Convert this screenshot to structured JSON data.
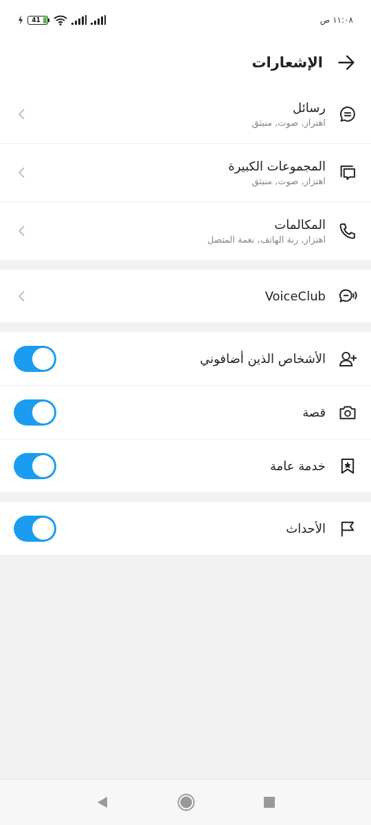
{
  "status_bar": {
    "time": "١١:٠٨ ص",
    "battery": {
      "text": "41"
    }
  },
  "header": {
    "title": "الإشعارات"
  },
  "sections": [
    {
      "rows": [
        {
          "kind": "link",
          "title": "رسائل",
          "subtitle": "اهتزاز, صوت, منبثق"
        },
        {
          "kind": "link",
          "title": "المجموعات الكبيرة",
          "subtitle": "اهتزاز, صوت, منبثق"
        },
        {
          "kind": "link",
          "title": "المكالمات",
          "subtitle": "اهتزاز, رنة الهاتف, نغمة المتصل"
        }
      ]
    },
    {
      "rows": [
        {
          "kind": "link",
          "title": "VoiceClub"
        }
      ]
    },
    {
      "rows": [
        {
          "kind": "toggle",
          "title": "الأشخاص الذين أضافوني",
          "on": true
        },
        {
          "kind": "toggle",
          "title": "قصة",
          "on": true
        },
        {
          "kind": "toggle",
          "title": "خدمة عامة",
          "on": true
        }
      ]
    },
    {
      "rows": [
        {
          "kind": "toggle",
          "title": "الأحداث",
          "on": true
        }
      ]
    }
  ]
}
